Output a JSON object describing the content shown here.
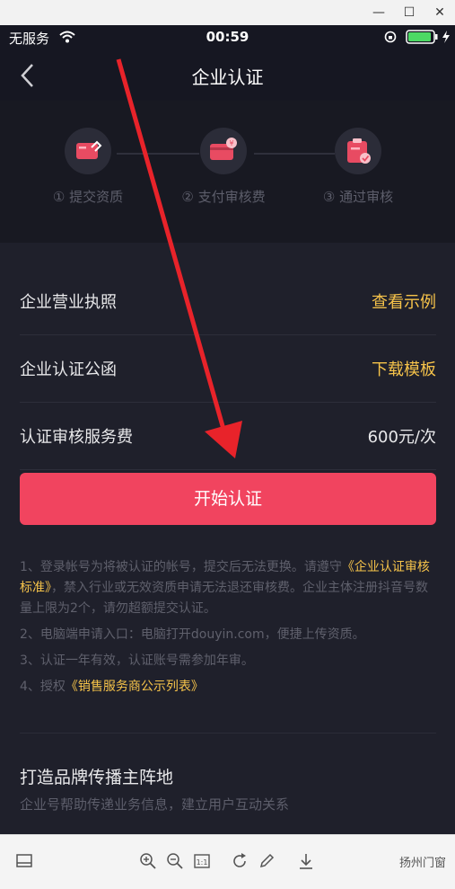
{
  "window": {
    "minimize": "—",
    "maximize": "☐",
    "close": "✕"
  },
  "status_bar": {
    "carrier": "无服务",
    "time": "00:59"
  },
  "nav": {
    "title": "企业认证"
  },
  "steps": [
    {
      "label": "① 提交资质"
    },
    {
      "label": "② 支付审核费"
    },
    {
      "label": "③ 通过审核"
    }
  ],
  "rows": [
    {
      "key": "企业营业执照",
      "value": "查看示例",
      "value_color": "#f6c34a"
    },
    {
      "key": "企业认证公函",
      "value": "下载模板",
      "value_color": "#f6c34a"
    },
    {
      "key": "认证审核服务费",
      "value": "600元/次",
      "value_color": "#e8e8ea"
    }
  ],
  "cta": {
    "label": "开始认证",
    "color": "#f1445f"
  },
  "notes": {
    "n1_a": "1、登录帐号为将被认证的帐号，提交后无法更换。请遵守",
    "n1_link": "《企业认证审核标准》",
    "n1_b": "，禁入行业或无效资质申请无法退还审核费。企业主体注册抖音号数量上限为2个，请勿超额提交认证。",
    "n2": "2、电脑端申请入口：电脑打开douyin.com，便捷上传资质。",
    "n3": "3、认证一年有效，认证账号需参加年审。",
    "n4_a": "4、授权",
    "n4_link": "《销售服务商公示列表》"
  },
  "brand": {
    "title": "打造品牌传播主阵地",
    "subtitle": "企业号帮助传递业务信息，建立用户互动关系"
  },
  "toolbar": {
    "watermark": "扬州门窗"
  }
}
